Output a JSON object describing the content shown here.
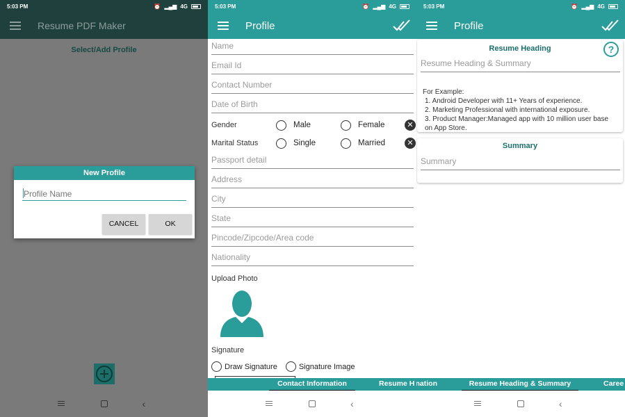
{
  "screen1": {
    "status_time": "5:03 PM",
    "status_network": "4G",
    "app_title": "Resume PDF Maker",
    "select_label": "Select/Add Profile",
    "dialog": {
      "title": "New Profile",
      "placeholder": "Profile Name",
      "cancel_label": "CANCEL",
      "ok_label": "OK"
    }
  },
  "screen2": {
    "status_time": "5:03 PM",
    "status_network": "4G",
    "title": "Profile",
    "fields": {
      "name": "Name",
      "email": "Email Id",
      "contact": "Contact Number",
      "dob": "Date of Birth",
      "passport": "Passport detail",
      "address": "Address",
      "city": "City",
      "state": "State",
      "pincode": "Pincode/Zipcode/Area code",
      "nationality": "Nationality"
    },
    "gender": {
      "label": "Gender",
      "option1": "Male",
      "option2": "Female"
    },
    "marital": {
      "label": "Marital Status",
      "option1": "Single",
      "option2": "Married"
    },
    "upload_photo": "Upload Photo",
    "signature": {
      "label": "Signature",
      "draw": "Draw Signature",
      "image": "Signature Image"
    },
    "tabs": {
      "active": "Contact Information",
      "next": "Resume H"
    }
  },
  "screen3": {
    "status_time": "5:03 PM",
    "status_network": "4G",
    "title": "Profile",
    "heading_card": {
      "title": "Resume Heading",
      "field": "Resume Heading & Summary",
      "example_title": "For Example:",
      "examples": [
        "1. Android Developer with 11+ Years of experience.",
        "2. Marketing Professional with international exposure.",
        "3. Product Manager:Managed app with 10 million user base on App Store."
      ]
    },
    "summary_card": {
      "title": "Summary",
      "field": "Summary"
    },
    "tabs": {
      "prev": "nation",
      "active": "Resume Heading & Summary",
      "next": "Caree"
    }
  },
  "colors": {
    "teal": "#2a9d9a",
    "dark_teal": "#1f403d",
    "overlay_gray": "#7a7a7a"
  }
}
